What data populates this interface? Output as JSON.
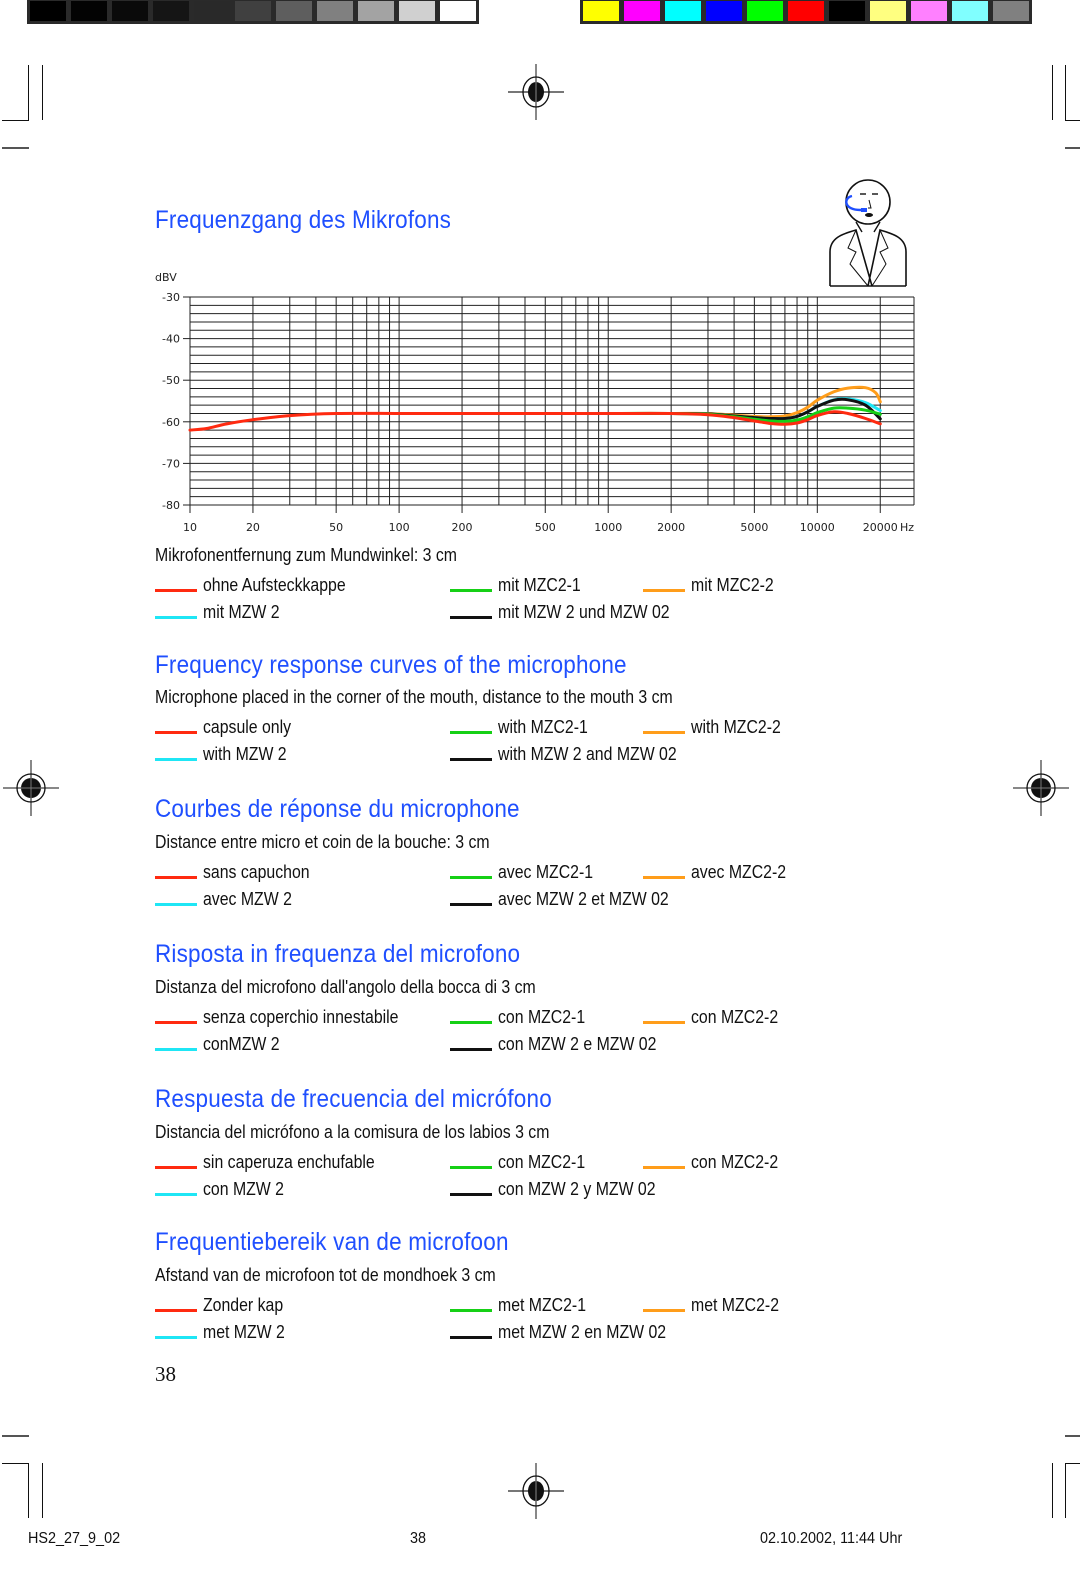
{
  "color_bar": {
    "grayscale": [
      "#000000",
      "#030303",
      "#0a0a0a",
      "#151515",
      "#292929",
      "#404040",
      "#5e5e5e",
      "#808080",
      "#a3a3a3",
      "#d0d0d0",
      "#ffffff"
    ],
    "process_colors": [
      "#ffff00",
      "#ff00ff",
      "#00ffff",
      "#0000ff",
      "#00ff00",
      "#ff0000",
      "#000000",
      "#ffff80",
      "#ff80ff",
      "#80ffff",
      "#808080"
    ]
  },
  "illustration": {
    "name": "person-with-headset"
  },
  "colors": {
    "heading": "#1f4fff",
    "red": "#ff2a10",
    "green": "#16d016",
    "orange": "#ff9d1a",
    "cyan": "#1fe6f5",
    "black": "#111111"
  },
  "chart_data": {
    "type": "line",
    "title": "Frequenzgang des Mikrofons",
    "xlabel": "Hz",
    "ylabel": "dBV",
    "xscale": "log",
    "xlim": [
      10,
      29000
    ],
    "ylim": [
      -80,
      -30
    ],
    "grid": true,
    "xticks": [
      10,
      20,
      50,
      100,
      200,
      500,
      1000,
      2000,
      5000,
      10000,
      20000
    ],
    "xtick_labels": [
      "10",
      "20",
      "50",
      "100",
      "200",
      "500",
      "1000",
      "2000",
      "5000",
      "10000",
      "20000"
    ],
    "yticks": [
      -30,
      -40,
      -50,
      -60,
      -70,
      -80
    ],
    "ytick_labels": [
      "-30",
      "-40",
      "-50",
      "-60",
      "-70",
      "-80"
    ],
    "x_unit_label": "Hz",
    "series": [
      {
        "name": "ohne Aufsteckkappe",
        "color": "red",
        "x": [
          10,
          12,
          15,
          20,
          30,
          50,
          100,
          200,
          500,
          1000,
          2000,
          3000,
          4000,
          5000,
          6000,
          7000,
          8000,
          9000,
          10000,
          12000,
          14000,
          17000,
          20000
        ],
        "y": [
          -62,
          -61.6,
          -60.5,
          -59.5,
          -58.5,
          -58,
          -58,
          -58,
          -58,
          -58,
          -58,
          -58.3,
          -59,
          -59.8,
          -60.4,
          -60.6,
          -60.3,
          -59.5,
          -58.5,
          -57.6,
          -58,
          -59.2,
          -60.5
        ]
      },
      {
        "name": "mit MZC2-1",
        "color": "green",
        "x": [
          1000,
          2000,
          3000,
          4000,
          5000,
          6000,
          7000,
          8000,
          9000,
          10000,
          12000,
          14000,
          17000,
          20000
        ],
        "y": [
          -58,
          -58,
          -58.2,
          -58.8,
          -59.4,
          -59.8,
          -59.9,
          -59.6,
          -58.8,
          -57.8,
          -56.7,
          -56.7,
          -57.2,
          -58.2
        ]
      },
      {
        "name": "mit MZC2-2",
        "color": "orange",
        "x": [
          1000,
          2000,
          3000,
          4000,
          5000,
          6000,
          7000,
          8000,
          9000,
          10000,
          12000,
          14000,
          17000,
          19000,
          20000
        ],
        "y": [
          -58,
          -58,
          -58,
          -58.4,
          -58.7,
          -58.8,
          -58.6,
          -57.8,
          -56.5,
          -54.8,
          -52.8,
          -51.9,
          -51.8,
          -53,
          -55.2
        ]
      },
      {
        "name": "mit MZW 2",
        "color": "cyan",
        "x": [
          1000,
          2000,
          3000,
          4000,
          5000,
          6000,
          7000,
          8000,
          9000,
          10000,
          12000,
          14000,
          17000,
          20000
        ],
        "y": [
          -58,
          -58,
          -58.1,
          -58.6,
          -59,
          -59.2,
          -59.2,
          -58.7,
          -57.6,
          -56.3,
          -54.7,
          -54.5,
          -55.4,
          -57.3
        ]
      },
      {
        "name": "mit MZW 2 und MZW 02",
        "color": "black",
        "x": [
          1000,
          2000,
          3000,
          4000,
          5000,
          6000,
          7000,
          8000,
          9000,
          10000,
          12000,
          14000,
          17000,
          20000
        ],
        "y": [
          -58,
          -58,
          -58.1,
          -58.6,
          -59,
          -59.2,
          -59.2,
          -58.7,
          -57.6,
          -56.3,
          -54.8,
          -54.7,
          -56,
          -59.3
        ]
      }
    ]
  },
  "sections": [
    {
      "lang": "de",
      "heading": "Frequenzgang des Mikrofons",
      "subline": "Mikrofonentfernung zum Mundwinkel: 3 cm",
      "legend": [
        "ohne Aufsteckkappe",
        "mit MZC2-1",
        "mit MZC2-2",
        "mit MZW 2",
        "mit MZW 2 und MZW 02"
      ]
    },
    {
      "lang": "en",
      "heading": "Frequency response curves of the microphone",
      "subline": "Microphone placed in the corner of the mouth, distance to the mouth 3 cm",
      "legend": [
        "capsule only",
        "with MZC2-1",
        "with MZC2-2",
        "with MZW 2",
        "with MZW 2 and MZW 02"
      ]
    },
    {
      "lang": "fr",
      "heading": "Courbes de réponse du microphone",
      "subline": "Distance entre micro et coin de la bouche: 3 cm",
      "legend": [
        "sans capuchon",
        "avec MZC2-1",
        "avec MZC2-2",
        "avec MZW 2",
        "avec MZW 2 et MZW 02"
      ]
    },
    {
      "lang": "it",
      "heading": "Risposta in frequenza del microfono",
      "subline": "Distanza del microfono dall'angolo della bocca di 3 cm",
      "legend": [
        "senza coperchio innestabile",
        "con MZC2-1",
        "con MZC2-2",
        "conMZW 2",
        "con MZW 2 e MZW 02"
      ]
    },
    {
      "lang": "es",
      "heading": "Respuesta de frecuencia del micrófono",
      "subline": "Distancia del micrófono a la comisura de los labios 3 cm",
      "legend": [
        "sin caperuza enchufable",
        "con MZC2-1",
        "con MZC2-2",
        "con MZW 2",
        "con MZW 2 y MZW 02"
      ]
    },
    {
      "lang": "nl",
      "heading": "Frequentiebereik van de microfoon",
      "subline": "Afstand van de microfoon tot de mondhoek 3 cm",
      "legend": [
        "Zonder kap",
        "met MZC2-1",
        "met MZC2-2",
        "met MZW 2",
        "met MZW 2 en MZW 02"
      ]
    }
  ],
  "page_number": "38",
  "footer": {
    "left": "HS2_27_9_02",
    "center": "38",
    "right": "02.10.2002, 11:44 Uhr"
  }
}
